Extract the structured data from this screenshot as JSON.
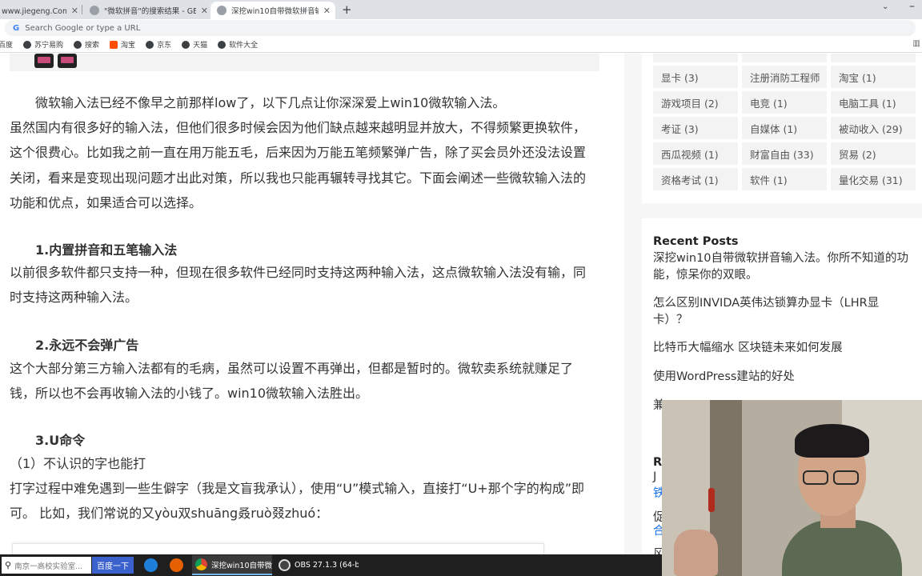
{
  "browser": {
    "tabs": [
      {
        "label": "www.jiegeng.Com]_桔",
        "active": false
      },
      {
        "label": "\"微软拼音\"的搜索结果 - GERRY",
        "active": false
      },
      {
        "label": "深挖win10自带微软拼音输入法。",
        "active": true
      }
    ],
    "new_tab_icon": "+",
    "omnibox_placeholder": "Search Google or type a URL",
    "bookmarks": [
      {
        "label": "百度",
        "icon": "baidu-icon"
      },
      {
        "label": "苏宁易购",
        "icon": "globe-icon"
      },
      {
        "label": "搜索",
        "icon": "globe-icon"
      },
      {
        "label": "淘宝",
        "icon": "taobao-icon"
      },
      {
        "label": "京东",
        "icon": "globe-icon"
      },
      {
        "label": "天猫",
        "icon": "globe-icon"
      },
      {
        "label": "软件大全",
        "icon": "globe-icon"
      }
    ]
  },
  "article": {
    "intro": "微软输入法已经不像早之前那样low了，以下几点让你深深爱上win10微软输入法。",
    "para1": "虽然国内有很多好的输入法，但他们很多时候会因为他们缺点越来越明显并放大，不得频繁更换软件，这个很费心。比如我之前一直在用万能五毛，后来因为万能五笔频繁弹广告，除了买会员外还没法设置关闭，看来是变现出现问题才出此对策，所以我也只能再辗转寻找其它。下面会阐述一些微软输入法的功能和优点，如果适合可以选择。",
    "h1": "1.内置拼音和五笔输入法",
    "para2": "以前很多软件都只支持一种，但现在很多软件已经同时支持这两种输入法，这点微软输入法没有输，同时支持这两种输入法。",
    "h2": "2.永远不会弹广告",
    "para3": "这个大部分第三方输入法都有的毛病，虽然可以设置不再弹出，但都是暂时的。微软卖系统就赚足了钱，所以也不会再收输入法的小钱了。win10微软输入法胜出。",
    "h3": "3.U命令",
    "sub1": "（1）不认识的字也能打",
    "para4": "打字过程中难免遇到一些生僻字（我是文盲我承认），使用“U”模式输入，直接打“U+那个字的构成”即可。 比如，我们常说的又yòu双shuāng叒ruò叕zhuó："
  },
  "sidebar": {
    "tags": [
      "显卡 (3)",
      "注册消防工程师",
      "淘宝 (1)",
      "游戏项目 (2)",
      "电竞 (1)",
      "电脑工具 (1)",
      "考证 (3)",
      "自媒体 (1)",
      "被动收入 (29)",
      "西瓜视频 (1)",
      "财富自由 (33)",
      "贸易 (2)",
      "资格考试 (1)",
      "软件 (1)",
      "量化交易 (31)"
    ],
    "recent_title": "Recent Posts",
    "recent_posts": [
      "深挖win10自带微软拼音输入法。你所不知道的功能，惊呆你的双眼。",
      "怎么区别INVIDA英伟达锁算办显卡（LHR显卡）？",
      "比特币大幅缩水 区块链未来如何发展",
      "使用WordPress建站的好处",
      "兼"
    ],
    "second_title": "R",
    "second_frags": [
      "J",
      "铁",
      "促",
      "合",
      "风"
    ]
  },
  "taskbar": {
    "search_value": "南京一高校实验室...",
    "search_button": "百度一下",
    "apps": [
      {
        "label": "深挖win10自带微...",
        "active": true
      },
      {
        "label": "OBS 27.1.3 (64-bi...",
        "active": false
      }
    ]
  },
  "colors": {
    "tabbar_bg": "#dee1e6",
    "taskbar_bg": "#1f1f1f",
    "search_button_bg": "#3b62cc",
    "tag_bg": "#f3f3f3",
    "text": "#333333"
  }
}
